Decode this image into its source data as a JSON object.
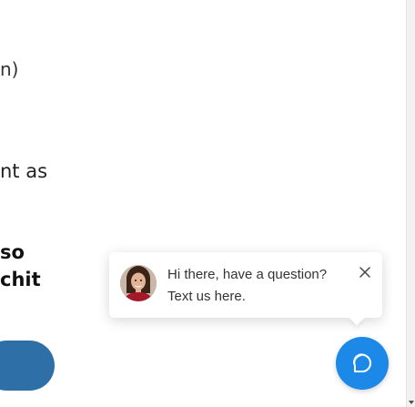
{
  "background_text": {
    "line1": "n)",
    "line2": "nt as",
    "line3": "so",
    "line4": "chit"
  },
  "chat_widget": {
    "message_line1": "Hi there, have a question?",
    "message_line2": "Text us here.",
    "close_icon": "close-icon",
    "launcher_icon": "chat-bubble-icon"
  },
  "colors": {
    "accent_blue": "#1c88e8",
    "button_blue": "#2f6fa8"
  }
}
